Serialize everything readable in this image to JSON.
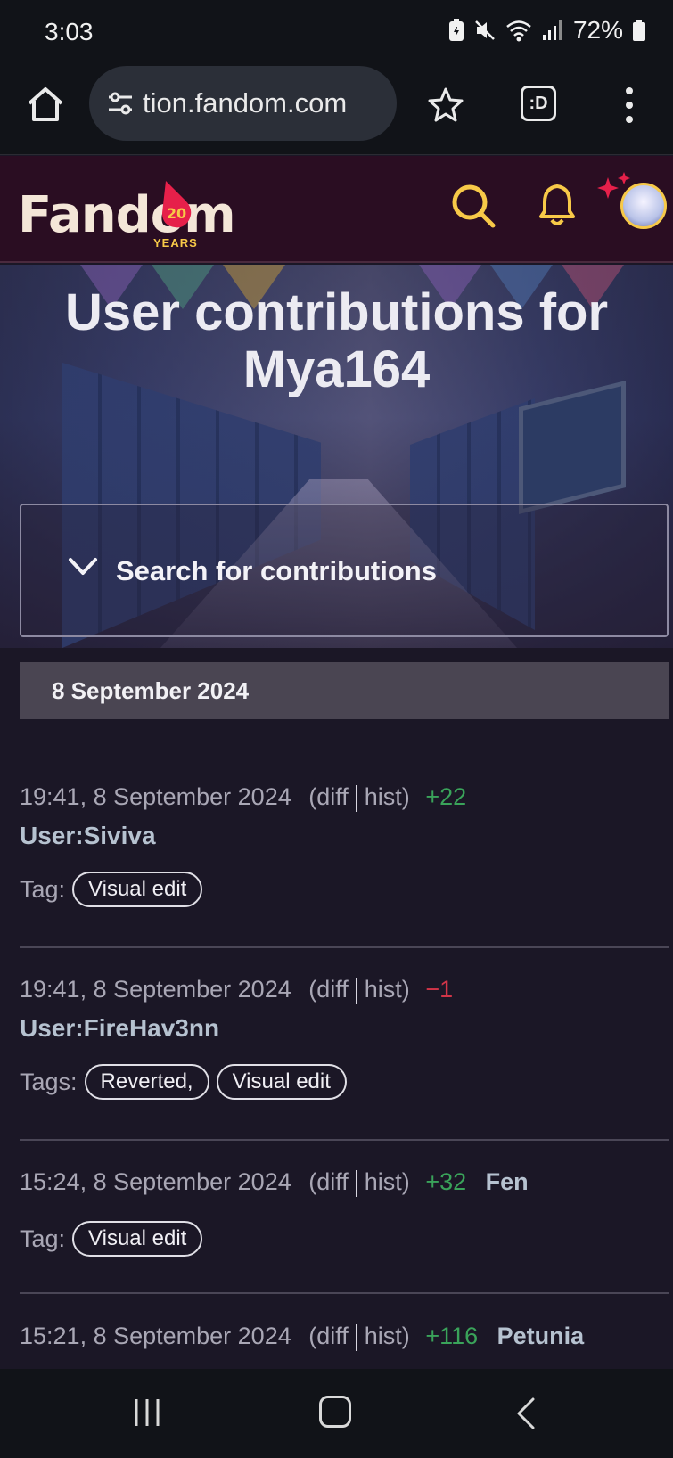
{
  "status_bar": {
    "time": "3:03",
    "battery": "72%"
  },
  "browser": {
    "url": "tion.fandom.com",
    "tabs_label": ":D"
  },
  "header": {
    "logo_text": "Fandom",
    "logo_badge": "20",
    "logo_sub": "YEARS"
  },
  "page": {
    "title": "User contributions for Mya164",
    "search_panel_label": "Search for contributions",
    "date_heading": "8 September 2024"
  },
  "entries": [
    {
      "timestamp": "19:41, 8 September 2024",
      "diff": "(diff",
      "hist": "hist)",
      "delta": "+22",
      "page": "User:Siviva",
      "tag_label": "Tag:",
      "tags": [
        "Visual edit"
      ]
    },
    {
      "timestamp": "19:41, 8 September 2024",
      "diff": "(diff",
      "hist": "hist)",
      "delta": "−1",
      "page": "User:FireHav3nn",
      "tag_label": "Tags:",
      "tags": [
        "Reverted,",
        "Visual edit"
      ]
    },
    {
      "timestamp": "15:24, 8 September 2024",
      "diff": "(diff",
      "hist": "hist)",
      "delta": "+32",
      "page": "Fen",
      "tag_label": "Tag:",
      "tags": [
        "Visual edit"
      ]
    },
    {
      "timestamp": "15:21, 8 September 2024",
      "diff": "(diff",
      "hist": "hist)",
      "delta": "+116",
      "page": "Petunia"
    }
  ],
  "colors": {
    "accent_yellow": "#f7c948",
    "positive": "#3aa35a",
    "negative": "#d23548",
    "header_bg": "#2a0d22"
  }
}
